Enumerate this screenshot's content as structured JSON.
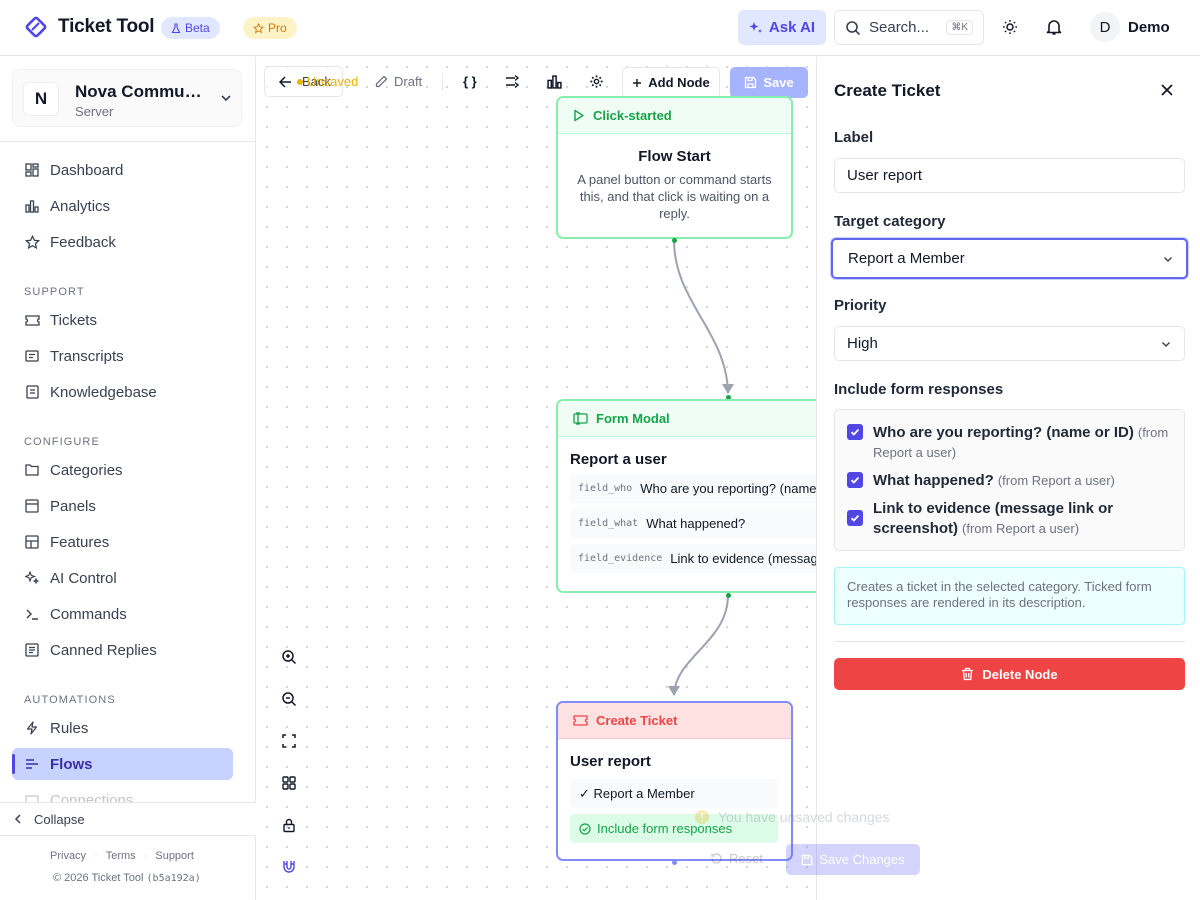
{
  "header": {
    "app_name": "Ticket Tool",
    "beta_label": "Beta",
    "pro_label": "Pro",
    "ask_ai_label": "Ask AI",
    "search_placeholder": "Search...",
    "search_shortcut": "⌘K",
    "user_initial": "D",
    "user_name": "Demo"
  },
  "sidebar": {
    "server": {
      "initial": "N",
      "name": "Nova Community",
      "type": "Server"
    },
    "nav_top": [
      {
        "label": "Dashboard",
        "icon": "dashboard-icon"
      },
      {
        "label": "Analytics",
        "icon": "bar-chart-icon"
      },
      {
        "label": "Feedback",
        "icon": "star-icon"
      }
    ],
    "sections": [
      {
        "title": "SUPPORT",
        "items": [
          {
            "label": "Tickets",
            "icon": "ticket-icon"
          },
          {
            "label": "Transcripts",
            "icon": "transcript-icon"
          },
          {
            "label": "Knowledgebase",
            "icon": "book-icon"
          }
        ]
      },
      {
        "title": "CONFIGURE",
        "items": [
          {
            "label": "Categories",
            "icon": "categories-icon"
          },
          {
            "label": "Panels",
            "icon": "panel-icon"
          },
          {
            "label": "Features",
            "icon": "features-icon"
          },
          {
            "label": "AI Control",
            "icon": "sparkle-icon"
          },
          {
            "label": "Commands",
            "icon": "terminal-icon"
          },
          {
            "label": "Canned Replies",
            "icon": "reply-icon"
          }
        ]
      },
      {
        "title": "AUTOMATIONS",
        "items": [
          {
            "label": "Rules",
            "icon": "lightning-icon"
          },
          {
            "label": "Flows",
            "icon": "flow-icon",
            "active": true
          },
          {
            "label": "Connections",
            "icon": "link-icon"
          }
        ]
      }
    ],
    "collapse_label": "Collapse",
    "footer_links": [
      "Privacy",
      "Terms",
      "Support"
    ],
    "copyright": "© 2026 Ticket Tool",
    "build": "(b5a192a)"
  },
  "canvas": {
    "toolbar": {
      "back_label": "Back",
      "unsaved_label": "Unsaved",
      "draft_label": "Draft",
      "add_node_label": "Add Node",
      "save_label": "Save"
    },
    "nodes": {
      "start": {
        "type_label": "Click-started",
        "title": "Flow Start",
        "description": "A panel button or command starts this, and that click is waiting on a reply."
      },
      "form": {
        "type_label": "Form Modal",
        "title": "Report a user",
        "fields": [
          {
            "key": "field_who",
            "label": "Who are you reporting? (name or ID)"
          },
          {
            "key": "field_what",
            "label": "What happened?"
          },
          {
            "key": "field_evidence",
            "label": "Link to evidence (message link or screenshot)"
          }
        ]
      },
      "ticket": {
        "type_label": "Create Ticket",
        "title": "User report",
        "category_tag": "✓ Report a Member",
        "include_tag": "Include form responses"
      }
    },
    "toast": {
      "message": "You have unsaved changes",
      "reset_label": "Reset",
      "save_label": "Save Changes"
    }
  },
  "panel": {
    "title": "Create Ticket",
    "label_field": {
      "label": "Label",
      "value": "User report"
    },
    "category_field": {
      "label": "Target category",
      "value": "Report a Member"
    },
    "priority_field": {
      "label": "Priority",
      "value": "High"
    },
    "include_label": "Include form responses",
    "responses": [
      {
        "text": "Who are you reporting? (name or ID)",
        "source": "(from Report a user)",
        "checked": true
      },
      {
        "text": "What happened?",
        "source": "(from Report a user)",
        "checked": true
      },
      {
        "text": "Link to evidence (message link or screenshot)",
        "source": "(from Report a user)",
        "checked": true
      }
    ],
    "info_text": "Creates a ticket in the selected category. Ticked form responses are rendered in its description.",
    "delete_label": "Delete Node"
  },
  "colors": {
    "accent": "#4f46e5",
    "success": "#16a34a",
    "danger": "#ef4444",
    "warning": "#eab308"
  }
}
